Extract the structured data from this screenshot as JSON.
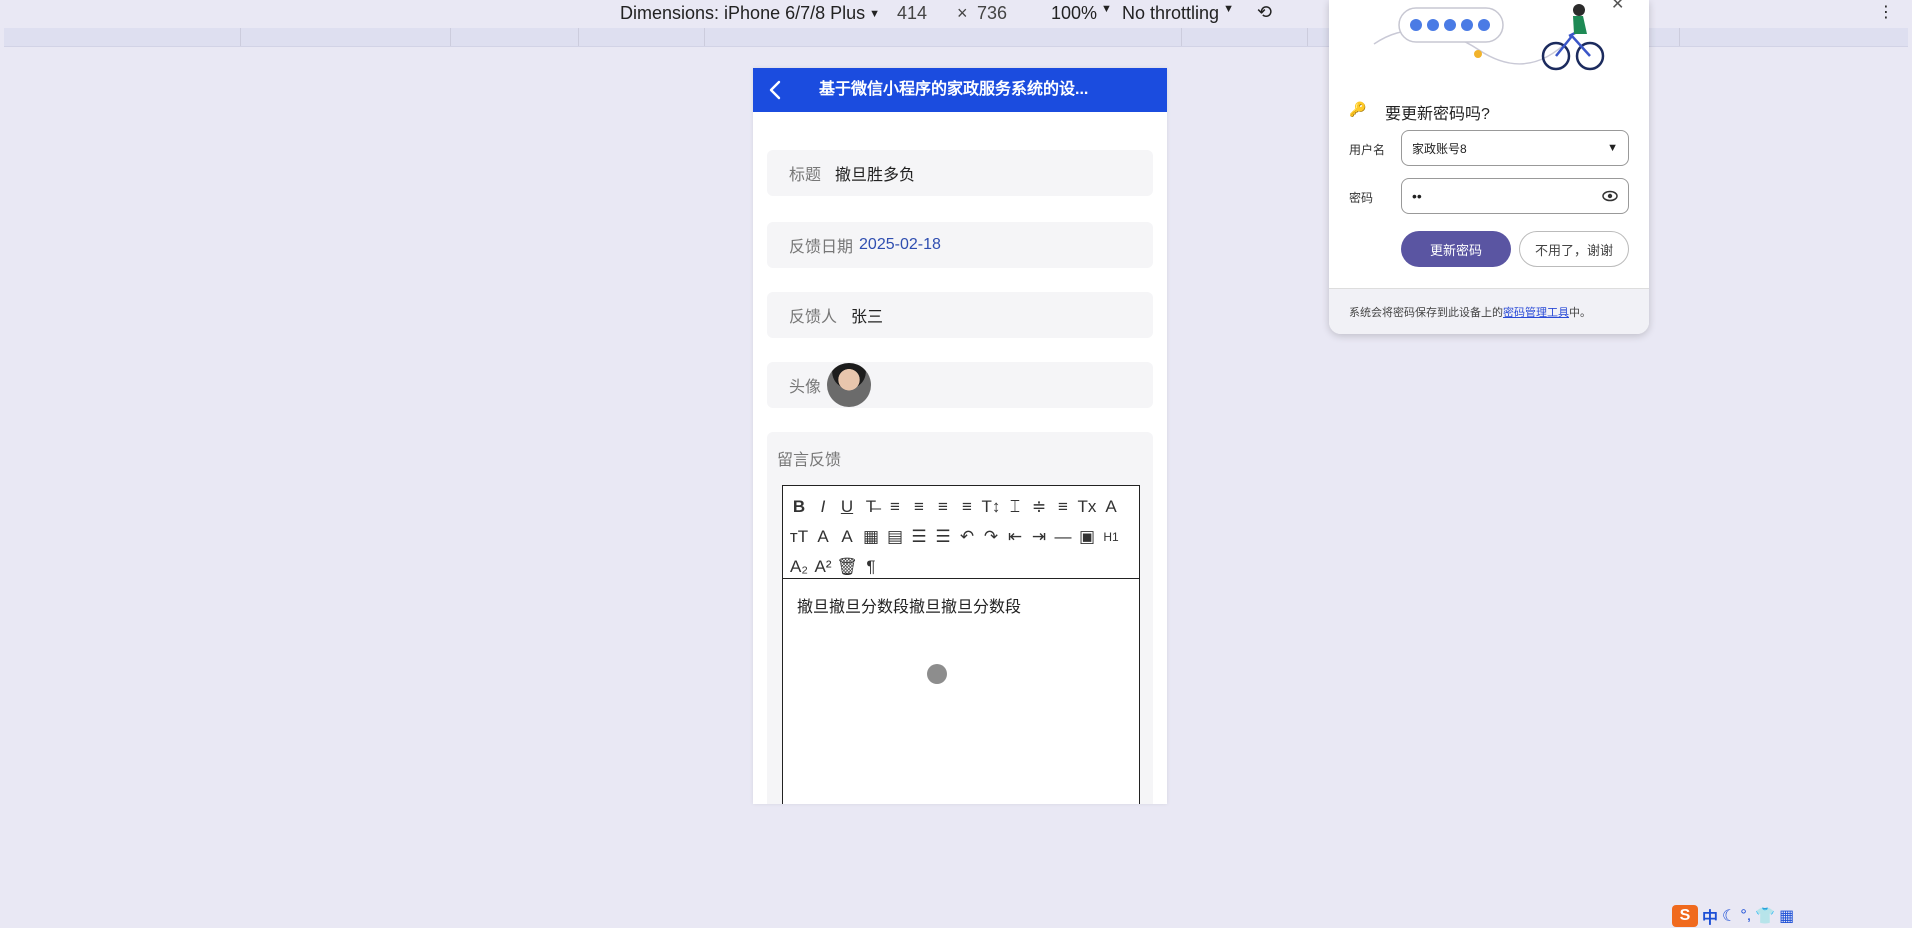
{
  "devtools": {
    "dimensions_label": "Dimensions: iPhone 6/7/8 Plus",
    "width": "414",
    "times": "×",
    "height": "736",
    "zoom": "100%",
    "throttling": "No throttling"
  },
  "app": {
    "nav_title": "基于微信小程序的家政服务系统的设...",
    "fields": {
      "title_label": "标题",
      "title_value": "撤旦胜多负",
      "date_label": "反馈日期",
      "date_value": "2025-02-18",
      "person_label": "反馈人",
      "person_value": "张三",
      "avatar_label": "头像",
      "message_label": "留言反馈"
    },
    "editor": {
      "content": "撤旦撤旦分数段撤旦撤旦分数段",
      "toolbar_row1": [
        "B",
        "I",
        "U",
        "T̶",
        "≡",
        "≡",
        "≡",
        "≡",
        "T↕",
        "⌶",
        "≑",
        "≡",
        "Tx",
        "A"
      ],
      "toolbar_row2": [
        "ᴛT",
        "A",
        "A",
        "▦",
        "▤",
        "☰",
        "☰",
        "↶",
        "↷",
        "⇤",
        "⇥",
        "—",
        "▣",
        "H1"
      ],
      "toolbar_row3": [
        "A₂",
        "A²",
        "🗑",
        "¶"
      ]
    }
  },
  "password_popup": {
    "heading": "要更新密码吗?",
    "username_label": "用户名",
    "username_value": "家政账号8",
    "password_label": "密码",
    "password_value": "••",
    "update_button": "更新密码",
    "decline_button": "不用了，谢谢",
    "footer_prefix": "系统会将密码保存到此设备上的",
    "footer_link": "密码管理工具",
    "footer_suffix": "中。"
  },
  "ime": {
    "logo": "S",
    "mode": "中"
  },
  "colors": {
    "nav_bg": "#1b4cdf",
    "primary_button": "#5a55a2",
    "date_text": "#2f4eb0"
  }
}
